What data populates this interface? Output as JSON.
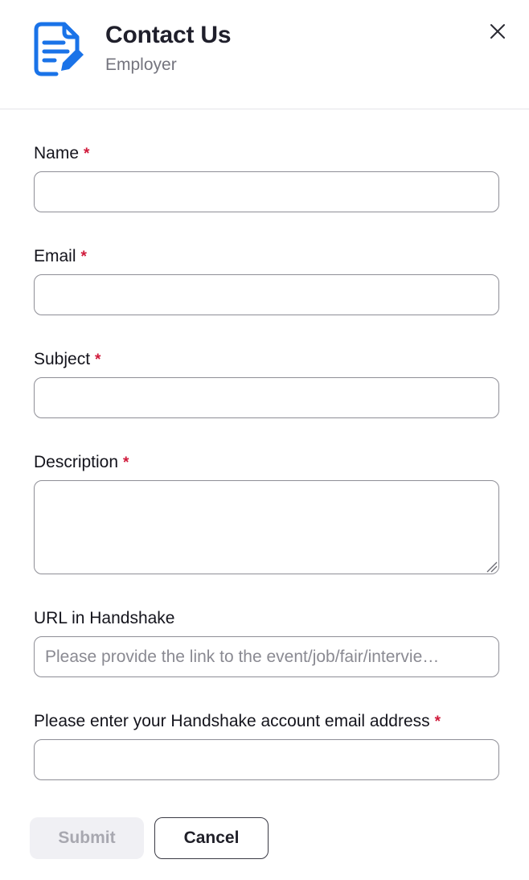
{
  "header": {
    "title": "Contact Us",
    "subtitle": "Employer",
    "icon": "form-edit-icon",
    "icon_color": "#1a73e8",
    "close_icon": "close-icon"
  },
  "form": {
    "required_marker": "*",
    "required_color": "#d0193a",
    "fields": [
      {
        "label": "Name",
        "required": true,
        "value": "",
        "placeholder": ""
      },
      {
        "label": "Email",
        "required": true,
        "value": "",
        "placeholder": ""
      },
      {
        "label": "Subject",
        "required": true,
        "value": "",
        "placeholder": ""
      },
      {
        "label": "Description",
        "required": true,
        "value": "",
        "placeholder": ""
      },
      {
        "label": "URL in Handshake",
        "required": false,
        "value": "",
        "placeholder": "Please provide the link to the event/job/fair/intervie…"
      },
      {
        "label": "Please enter your Handshake account email address",
        "required": true,
        "value": "",
        "placeholder": ""
      }
    ]
  },
  "actions": {
    "submit_label": "Submit",
    "submit_disabled": true,
    "cancel_label": "Cancel"
  }
}
